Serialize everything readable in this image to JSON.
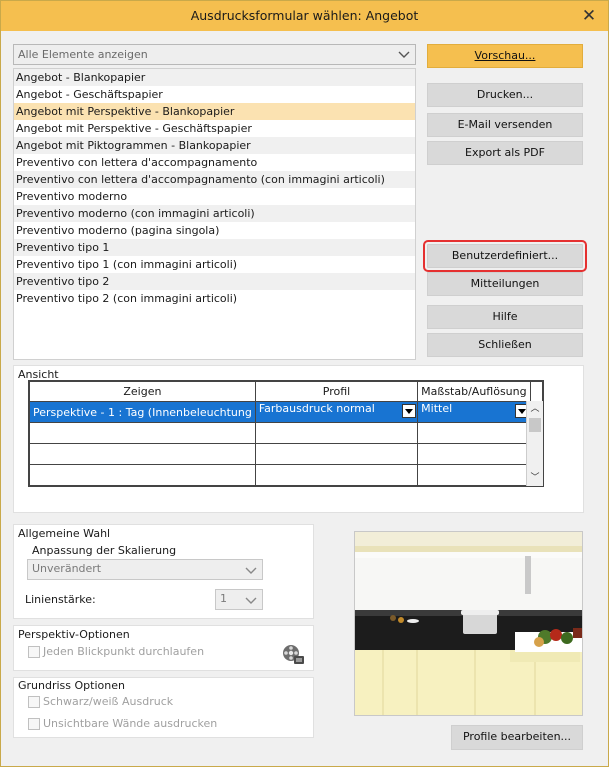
{
  "window": {
    "title": "Ausdrucksformular wählen: Angebot"
  },
  "filter": {
    "selected": "Alle Elemente anzeigen"
  },
  "forms": [
    "Angebot - Blankopapier",
    "Angebot - Geschäftspapier",
    "Angebot mit Perspektive - Blankopapier",
    "Angebot mit Perspektive - Geschäftspapier",
    "Angebot mit Piktogrammen - Blankopapier",
    "Preventivo con lettera d'accompagnamento",
    "Preventivo con lettera d'accompagnamento (con immagini articoli)",
    "Preventivo moderno",
    "Preventivo moderno (con immagini articoli)",
    "Preventivo moderno (pagina singola)",
    "Preventivo tipo 1",
    "Preventivo tipo 1 (con immagini articoli)",
    "Preventivo tipo 2",
    "Preventivo tipo 2 (con immagini articoli)"
  ],
  "buttons": {
    "vorschau": "Vorschau...",
    "drucken": "Drucken...",
    "email": "E-Mail versenden",
    "pdf": "Export als PDF",
    "benutzer": "Benutzerdefiniert...",
    "mitteilungen": "Mitteilungen",
    "hilfe": "Hilfe",
    "schliessen": "Schließen",
    "profile": "Profile bearbeiten..."
  },
  "ansicht": {
    "label": "Ansicht",
    "headers": [
      "Zeigen",
      "Profil",
      "Maßstab/Auflösung"
    ],
    "row": {
      "zeigen": "Perspektive - 1 : Tag (Innenbeleuchtung",
      "profil": "Farbausdruck normal",
      "massstab": "Mittel"
    }
  },
  "allgemein": {
    "label": "Allgemeine Wahl",
    "scale_label": "Anpassung der Skalierung",
    "scale_value": "Unverändert",
    "line_label": "Linienstärke:",
    "line_value": "1"
  },
  "perspektiv": {
    "label": "Perspektiv-Optionen",
    "option": "Jeden Blickpunkt durchlaufen"
  },
  "grundriss": {
    "label": "Grundriss Optionen",
    "option1": "Schwarz/weiß Ausdruck",
    "option2": "Unsichtbare Wände ausdrucken"
  },
  "colors": {
    "accent": "#f5bf4f",
    "selection": "#1874d2",
    "list_selection": "#fbe2b1",
    "focus": "#e53030"
  }
}
